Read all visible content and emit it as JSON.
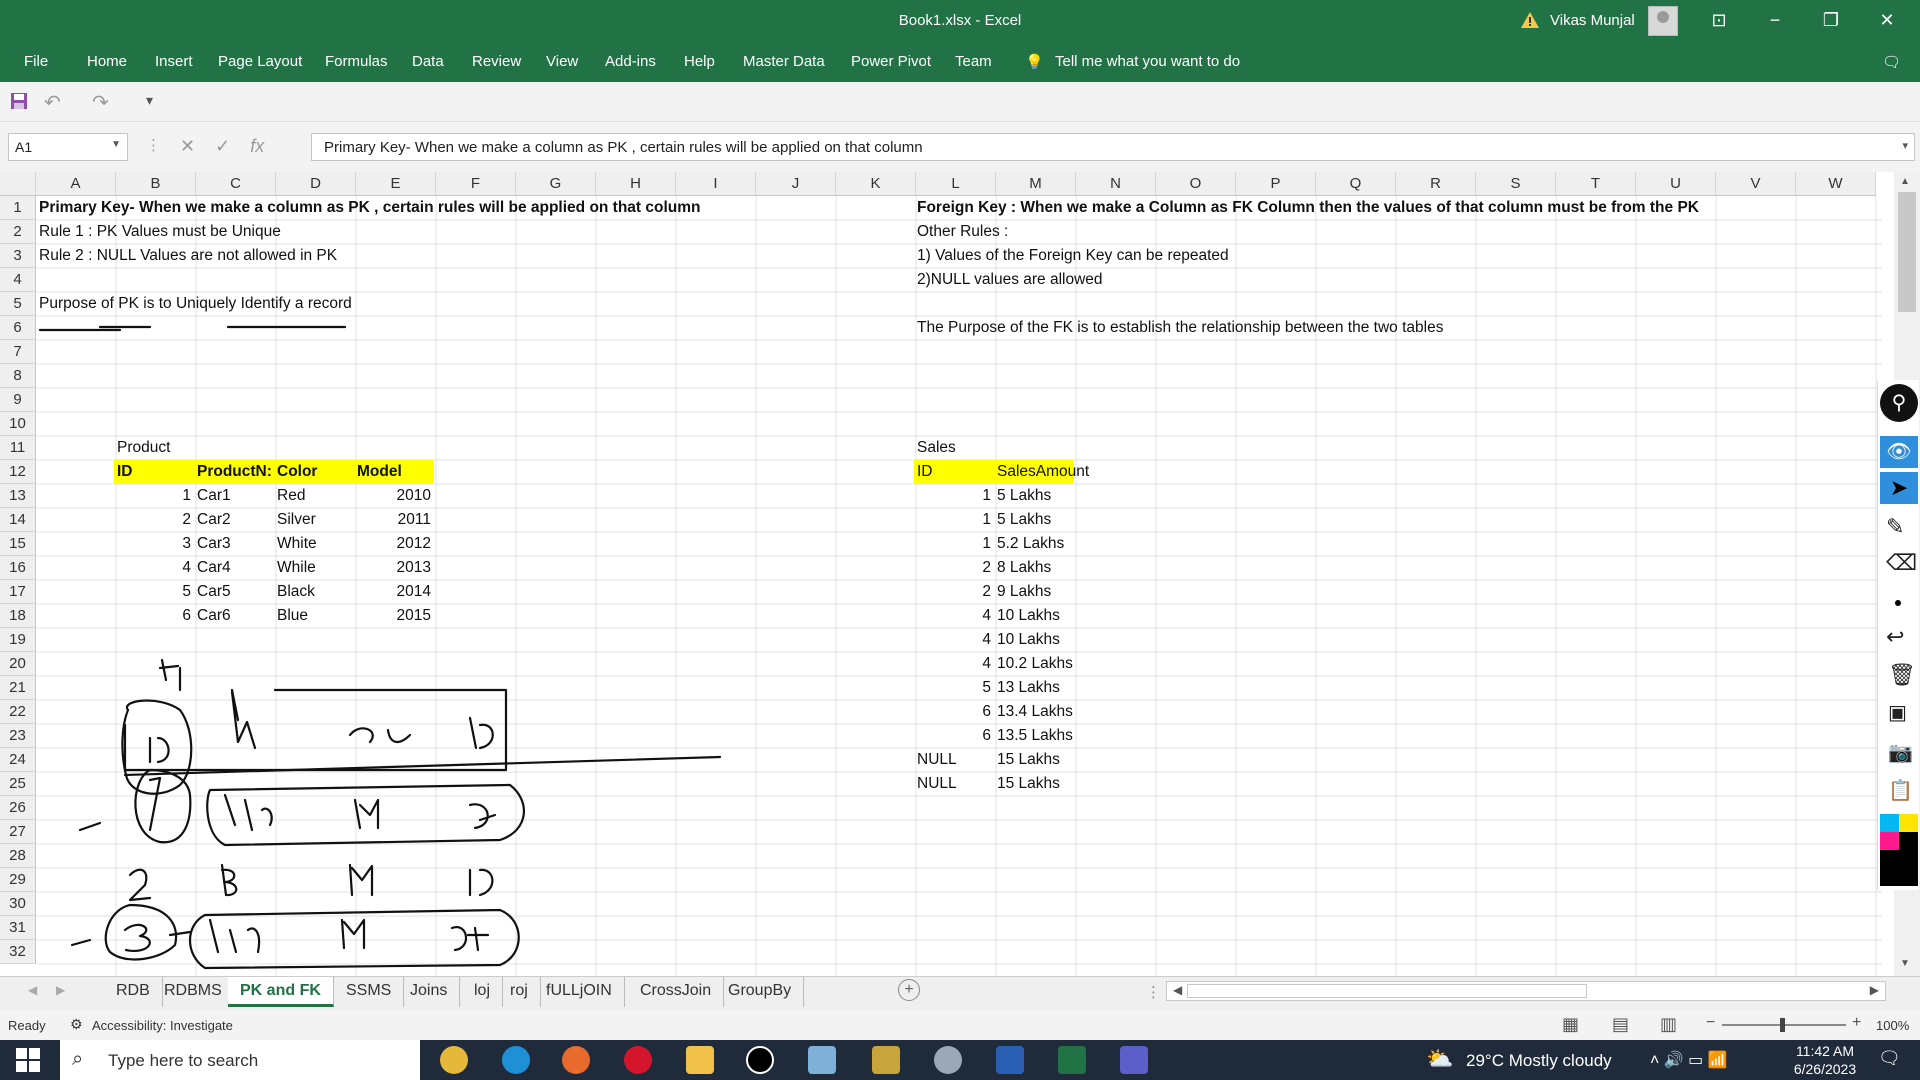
{
  "window": {
    "title": "Book1.xlsx  -  Excel",
    "user": "Vikas Munjal"
  },
  "ribbon": {
    "tabs": [
      "File",
      "Home",
      "Insert",
      "Page Layout",
      "Formulas",
      "Data",
      "Review",
      "View",
      "Add-ins",
      "Help",
      "Master Data",
      "Power Pivot",
      "Team"
    ],
    "tell_me": "Tell me what you want to do"
  },
  "formula_bar": {
    "name_box": "A1",
    "formula": "Primary Key-   When we make a column as PK , certain rules will be applied on that column",
    "fx": "fx"
  },
  "columns": [
    "A",
    "B",
    "C",
    "D",
    "E",
    "F",
    "G",
    "H",
    "I",
    "J",
    "K",
    "L",
    "M",
    "N",
    "O",
    "P",
    "Q",
    "R",
    "S",
    "T",
    "U",
    "V",
    "W"
  ],
  "rows": [
    "1",
    "2",
    "3",
    "4",
    "5",
    "6",
    "7",
    "8",
    "9",
    "10",
    "11",
    "12",
    "13",
    "14",
    "15",
    "16",
    "17",
    "18",
    "19",
    "20",
    "21",
    "22",
    "23",
    "24",
    "25",
    "26",
    "27",
    "28",
    "29",
    "30",
    "31",
    "32"
  ],
  "left_notes": {
    "r1": "Primary Key-   When we make a column as PK , certain rules will be applied on that column",
    "r2": "Rule 1 :  PK Values must be Unique",
    "r3": "Rule 2 : NULL Values are not allowed in PK",
    "r5": "Purpose of PK is to Uniquely Identify a record"
  },
  "right_notes": {
    "r1": "Foreign Key : When we make a Column as FK Column then the values of that column must be from the PK",
    "r2": "Other Rules :",
    "r3": "1) Values of the Foreign Key can be repeated",
    "r4": "2)NULL values are allowed",
    "r6": "The Purpose of the FK is to establish the relationship between the two tables"
  },
  "product": {
    "title": "Product",
    "headers": [
      "ID",
      "ProductN:",
      "Color",
      "Model"
    ],
    "rows": [
      [
        "1",
        "Car1",
        "Red",
        "2010"
      ],
      [
        "2",
        "Car2",
        "Silver",
        "2011"
      ],
      [
        "3",
        "Car3",
        "White",
        "2012"
      ],
      [
        "4",
        "Car4",
        "While",
        "2013"
      ],
      [
        "5",
        "Car5",
        "Black",
        "2014"
      ],
      [
        "6",
        "Car6",
        "Blue",
        "2015"
      ]
    ]
  },
  "sales": {
    "title": "Sales",
    "headers": [
      "ID",
      "SalesAmount"
    ],
    "rows": [
      [
        "1",
        "5 Lakhs"
      ],
      [
        "1",
        "5 Lakhs"
      ],
      [
        "1",
        "5.2 Lakhs"
      ],
      [
        "2",
        "8 Lakhs"
      ],
      [
        "2",
        "9 Lakhs"
      ],
      [
        "4",
        "10 Lakhs"
      ],
      [
        "4",
        "10 Lakhs"
      ],
      [
        "4",
        "10.2 Lakhs"
      ],
      [
        "5",
        "13 Lakhs"
      ],
      [
        "6",
        "13.4 Lakhs"
      ],
      [
        "6",
        "13.5 Lakhs"
      ],
      [
        "NULL",
        "15 Lakhs"
      ],
      [
        "NULL",
        "15 Lakhs"
      ]
    ]
  },
  "sheet_tabs": [
    "RDB",
    "RDBMS",
    "PK and FK",
    "SSMS",
    "Joins",
    "loj",
    "roj",
    "fULLjOIN",
    "CrossJoin",
    "GroupBy"
  ],
  "active_sheet": "PK and FK",
  "status": {
    "ready": "Ready",
    "accessibility": "Accessibility: Investigate",
    "zoom": "100%"
  },
  "taskbar": {
    "search": "Type here to search",
    "weather": "29°C  Mostly cloudy",
    "time": "11:42 AM",
    "date": "6/26/2023"
  },
  "colors": {
    "excel_green": "#217346",
    "header_yellow": "#ffff00"
  }
}
